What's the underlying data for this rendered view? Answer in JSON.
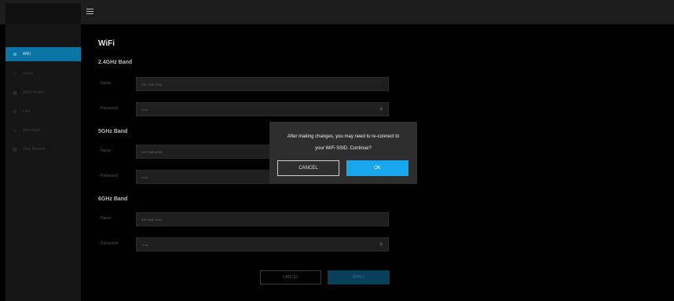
{
  "topbar": {
    "menu_icon": "hamburger-icon"
  },
  "sidebar": {
    "items": [
      {
        "label": "WiFi",
        "icon": "wifi-icon",
        "active": true
      },
      {
        "label": "Home",
        "icon": "home-icon",
        "active": false
      },
      {
        "label": "WAN Profile",
        "icon": "wan-profile-icon",
        "active": false
      },
      {
        "label": "LAN",
        "icon": "lan-icon",
        "active": false
      },
      {
        "label": "Wireshark",
        "icon": "wireshark-icon",
        "active": false
      },
      {
        "label": "Web Restore",
        "icon": "web-restore-icon",
        "active": false
      }
    ]
  },
  "main": {
    "title": "WiFi",
    "bands": [
      {
        "title": "2.4GHz Band",
        "name_label": "Name",
        "name_value": "WE ONE 1000",
        "password_label": "Password",
        "password_value": "••••••"
      },
      {
        "title": "5GHz Band",
        "name_label": "Name",
        "name_value": "WE ONE 5000",
        "password_label": "Password",
        "password_value": "••••••"
      },
      {
        "title": "6GHz Band",
        "name_label": "Name",
        "name_value": "WE ONE 6000",
        "password_label": "Password",
        "password_value": "••••••"
      }
    ],
    "cancel_label": "CANCEL",
    "apply_label": "APPLY"
  },
  "dialog": {
    "message_line1": "After making changes, you may need to re-connect to",
    "message_line2": "your WiFi SSID. Continue?",
    "cancel_label": "CANCEL",
    "ok_label": "OK"
  },
  "colors": {
    "accent": "#18a7ee",
    "sidebar_active": "#0b76a6",
    "dialog_bg": "#2e2e2e"
  }
}
